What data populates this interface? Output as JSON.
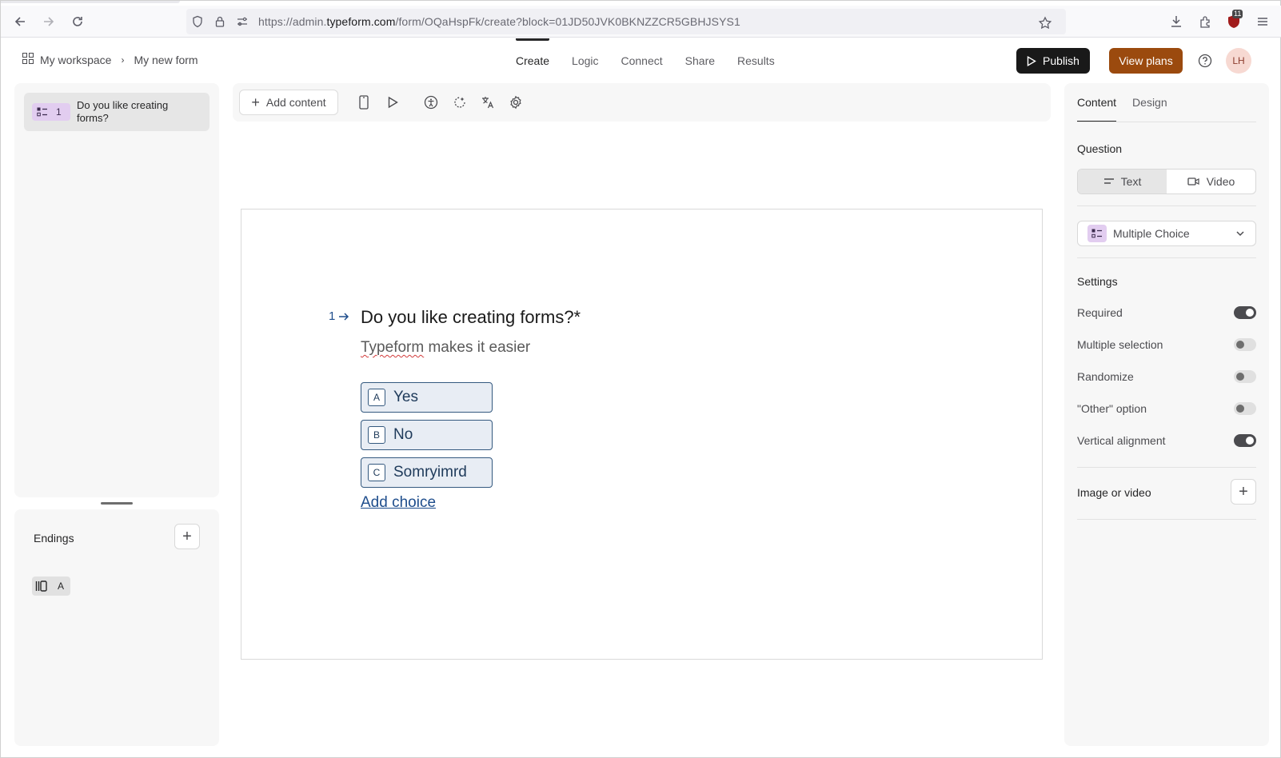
{
  "browser": {
    "url_prefix": "https://admin.",
    "url_domain": "typeform.com",
    "url_path": "/form/OQaHspFk/create?block=01JD50JVK0BKNZZCR5GBHJSYS1",
    "extension_badge": "11"
  },
  "header": {
    "breadcrumb": [
      "My workspace",
      "My new form"
    ],
    "tabs": [
      "Create",
      "Logic",
      "Connect",
      "Share",
      "Results"
    ],
    "active_tab": "Create",
    "publish_label": "Publish",
    "view_plans_label": "View plans",
    "avatar_initials": "LH"
  },
  "left": {
    "questions": [
      {
        "number": "1",
        "title": "Do you like creating forms?"
      }
    ],
    "endings_label": "Endings",
    "ending_badge": "A"
  },
  "toolbar": {
    "add_content_label": "Add content"
  },
  "question": {
    "number": "1",
    "title": "Do you like creating forms?*",
    "description_misspelled": "Typeform",
    "description_rest": " makes it easier",
    "choices": [
      {
        "key": "A",
        "label": "Yes"
      },
      {
        "key": "B",
        "label": "No"
      },
      {
        "key": "C",
        "label": "Somryimrd"
      }
    ],
    "add_choice_label": "Add choice"
  },
  "right": {
    "tabs": [
      "Content",
      "Design"
    ],
    "active_tab": "Content",
    "question_label": "Question",
    "question_modes": [
      "Text",
      "Video"
    ],
    "question_mode_selected": "Text",
    "type_selected": "Multiple Choice",
    "settings_label": "Settings",
    "settings": [
      {
        "label": "Required",
        "on": true
      },
      {
        "label": "Multiple selection",
        "on": false
      },
      {
        "label": "Randomize",
        "on": false
      },
      {
        "label": "\"Other\" option",
        "on": false
      },
      {
        "label": "Vertical alignment",
        "on": true
      }
    ],
    "image_video_label": "Image or video"
  },
  "colors": {
    "publish_bg": "#191919",
    "view_plans_bg": "#9b4a0e",
    "choice_accent": "#34597f",
    "question_type_badge": "#e2cdf0"
  }
}
